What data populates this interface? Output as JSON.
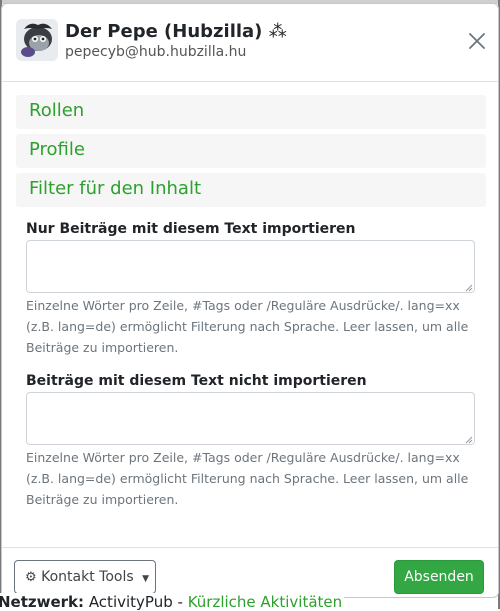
{
  "header": {
    "name": "Der Pepe (Hubzilla)",
    "name_badge": "⁂",
    "handle": "pepecyb@hub.hubzilla.hu",
    "avatar_icon": "avatar-image",
    "close_icon": "close-icon"
  },
  "accordion": [
    {
      "label": "Rollen"
    },
    {
      "label": "Profile"
    },
    {
      "label": "Filter für den Inhalt"
    }
  ],
  "filters": {
    "include_label": "Nur Beiträge mit diesem Text importieren",
    "include_value": "",
    "include_help": "Einzelne Wörter pro Zeile, #Tags oder /Reguläre Ausdrücke/. lang=xx (z.B. lang=de) ermöglicht Filterung nach Sprache. Leer lassen, um alle Beiträge zu importieren.",
    "exclude_label": "Beiträge mit diesem Text nicht importieren",
    "exclude_value": "",
    "exclude_help": "Einzelne Wörter pro Zeile, #Tags oder /Reguläre Ausdrücke/. lang=xx (z.B. lang=de) ermöglicht Filterung nach Sprache. Leer lassen, um alle Beiträge zu importieren."
  },
  "footer": {
    "tools_label": "Kontakt Tools",
    "tools_icon": "gear-icon",
    "submit_label": "Absenden"
  },
  "background": {
    "network_label": "Netzwerk:",
    "network_value": "ActivityPub",
    "separator": "-",
    "recent_link": "Kürzliche Aktivitäten"
  },
  "colors": {
    "accent": "#2da02d",
    "submit_bg": "#33a743",
    "accordion_bg": "#f6f6f6"
  }
}
